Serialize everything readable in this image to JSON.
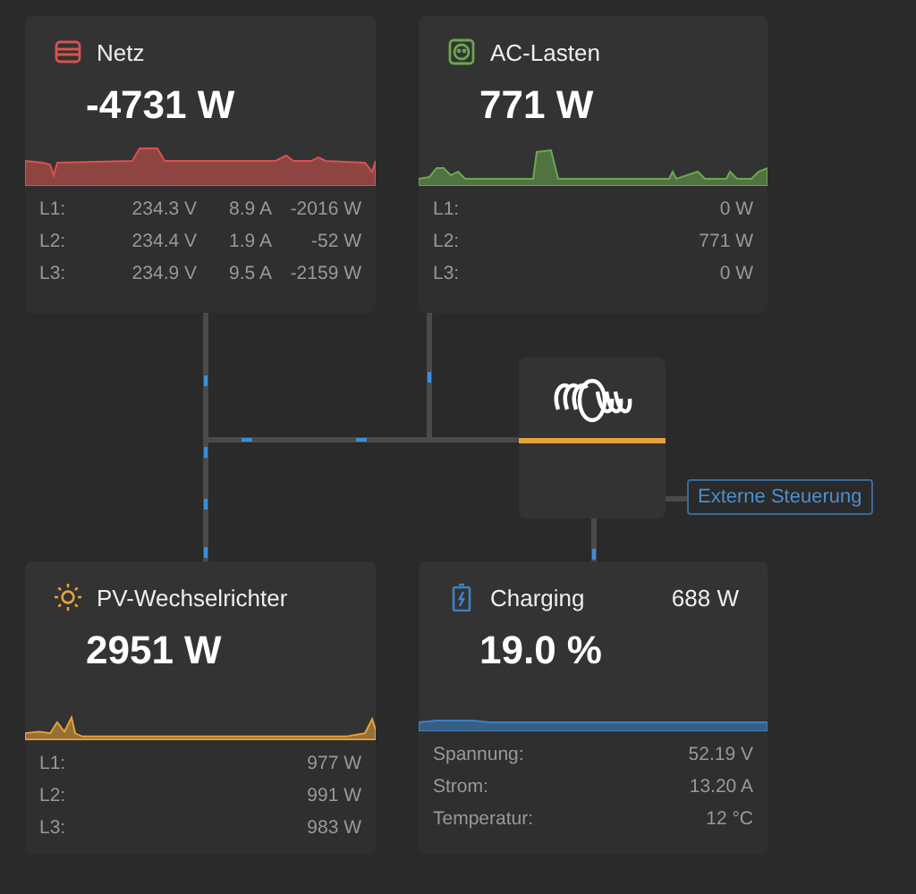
{
  "cards": [
    {
      "kind": "grid",
      "title": "Netz",
      "value": "-4731 W",
      "color": "#d9534f",
      "rows": [
        {
          "label": "L1:",
          "values": [
            "234.3 V",
            "8.9 A",
            "-2016 W"
          ]
        },
        {
          "label": "L2:",
          "values": [
            "234.4 V",
            "1.9 A",
            "-52 W"
          ]
        },
        {
          "label": "L3:",
          "values": [
            "234.9 V",
            "9.5 A",
            "-2159 W"
          ]
        }
      ]
    },
    {
      "kind": "loads",
      "title": "AC-Lasten",
      "value": "771 W",
      "color": "#6aa84f",
      "rows": [
        {
          "label": "L1:",
          "values": [
            "0 W"
          ]
        },
        {
          "label": "L2:",
          "values": [
            "771 W"
          ]
        },
        {
          "label": "L3:",
          "values": [
            "0 W"
          ]
        }
      ]
    },
    {
      "kind": "pv",
      "title": "PV-Wechselrichter",
      "value": "2951 W",
      "color": "#e8a23a",
      "rows": [
        {
          "label": "L1:",
          "values": [
            "977 W"
          ]
        },
        {
          "label": "L2:",
          "values": [
            "991 W"
          ]
        },
        {
          "label": "L3:",
          "values": [
            "983 W"
          ]
        }
      ]
    },
    {
      "kind": "battery",
      "title": "Charging",
      "header_value": "688 W",
      "value": "19.0 %",
      "color": "#3b82c4",
      "rows": [
        {
          "label": "Spannung:",
          "values": [
            "52.19 V"
          ]
        },
        {
          "label": "Strom:",
          "values": [
            "13.20 A"
          ]
        },
        {
          "label": "Temperatur:",
          "values": [
            "12 °C"
          ]
        }
      ]
    }
  ],
  "external_control": "Externe Steuerung"
}
